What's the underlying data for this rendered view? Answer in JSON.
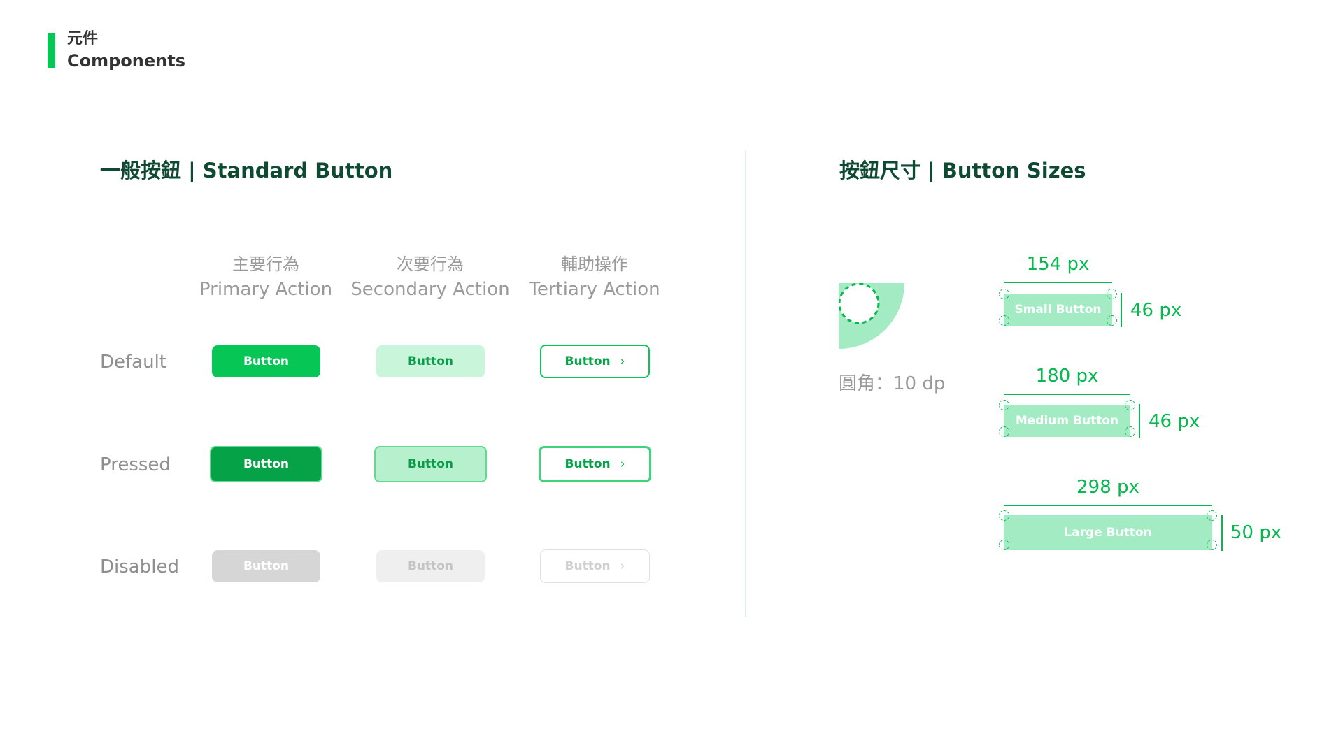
{
  "header": {
    "title_zh": "元件",
    "title_en": "Components"
  },
  "standard": {
    "title": "一般按鈕 | Standard Button",
    "columns": [
      {
        "zh": "主要行為",
        "en": "Primary Action"
      },
      {
        "zh": "次要行為",
        "en": "Secondary Action"
      },
      {
        "zh": "輔助操作",
        "en": "Tertiary Action"
      }
    ],
    "rows": [
      "Default",
      "Pressed",
      "Disabled"
    ],
    "button_label": "Button",
    "chevron": "›"
  },
  "sizes": {
    "title": "按鈕尺寸 | Button Sizes",
    "radius_label": "圓角：10 dp",
    "small": {
      "label": "Small Button",
      "width": "154 px",
      "height": "46 px"
    },
    "medium": {
      "label": "Medium Button",
      "width": "180 px",
      "height": "46 px"
    },
    "large": {
      "label": "Large Button",
      "width": "298 px",
      "height": "50 px"
    }
  },
  "colors": {
    "brand": "#06C755",
    "pressed": "#06A247",
    "secondary": "#C9F5DA",
    "disabled": "#D6D6D6",
    "title": "#0E4A33"
  }
}
